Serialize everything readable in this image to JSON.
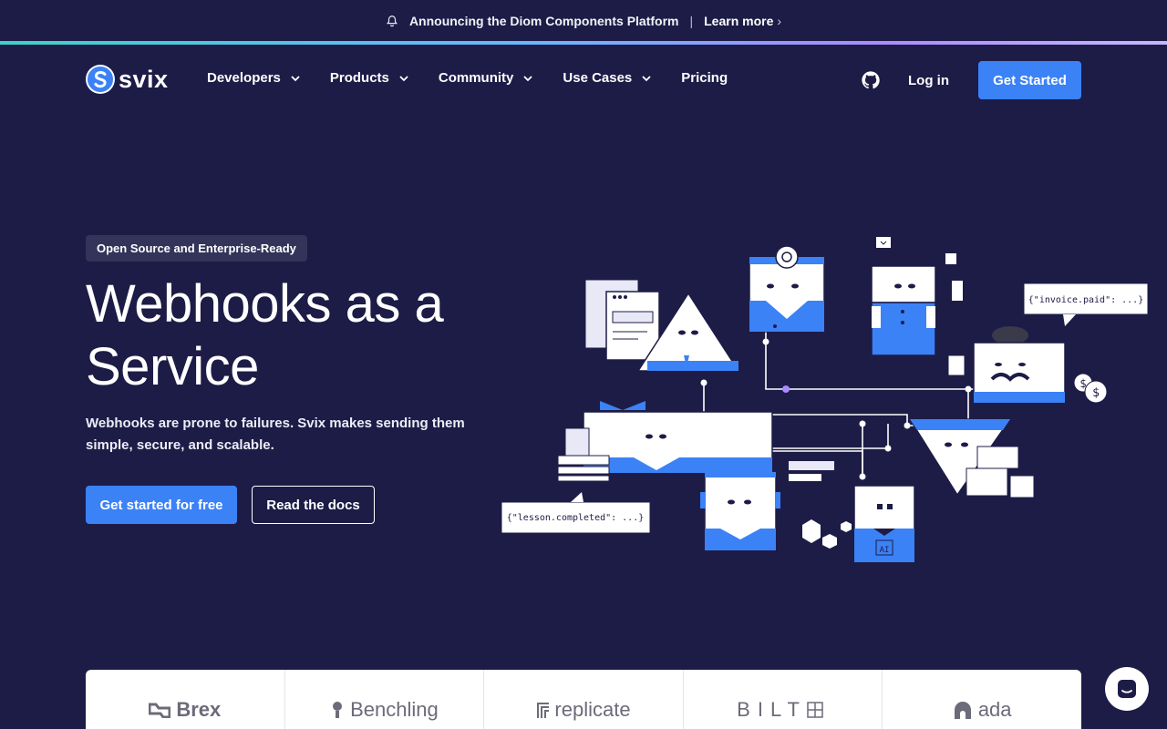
{
  "announcement": {
    "icon": "bell-icon",
    "text": "Announcing the Diom Components Platform",
    "separator": "|",
    "link": "Learn more",
    "chevron": "›"
  },
  "nav": {
    "brand": "svix",
    "items": [
      {
        "label": "Developers",
        "dropdown": true
      },
      {
        "label": "Products",
        "dropdown": true
      },
      {
        "label": "Community",
        "dropdown": true
      },
      {
        "label": "Use Cases",
        "dropdown": true
      },
      {
        "label": "Pricing",
        "dropdown": false
      }
    ],
    "caret": "⌄",
    "login": "Log in",
    "cta": "Get Started"
  },
  "hero": {
    "badge": "Open Source and Enterprise-Ready",
    "title_line1": "Webhooks as a",
    "title_line2": "Service",
    "subtitle": "Webhooks are prone to failures. Svix makes sending them simple, secure, and scalable.",
    "primary_cta": "Get started for free",
    "secondary_cta": "Read the docs"
  },
  "illustration": {
    "bubble_invoice": "{\"invoice.paid\": ...}",
    "bubble_lesson": "{\"lesson.completed\": ...}",
    "ai_label": "AI"
  },
  "customers": [
    "Brex",
    "Benchling",
    "replicate",
    "BILT",
    "ada"
  ],
  "colors": {
    "background": "#1d1c47",
    "accent": "#3b82f6",
    "badge": "#34335a"
  }
}
